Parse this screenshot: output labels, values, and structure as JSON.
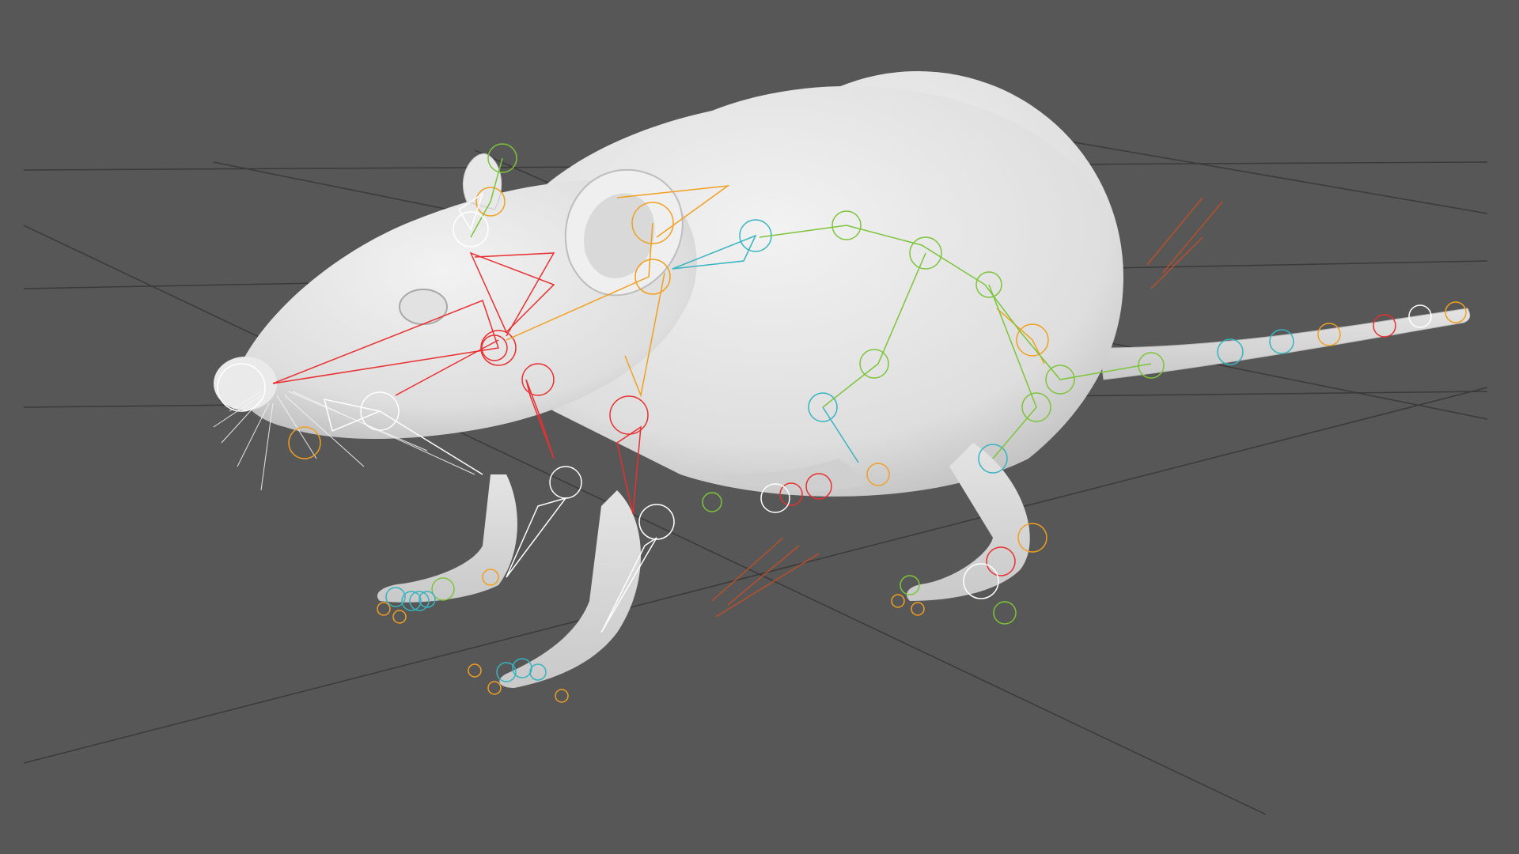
{
  "viewport": {
    "background": "#575757",
    "grid_color": "#3a3a3a",
    "mesh_color": "#e6e6e6"
  },
  "model": {
    "name_icon": "rat-mesh",
    "rig_colors": {
      "head": "#e83030",
      "spine": "#7cc43a",
      "neck": "#36b4c0",
      "shoulder": "#f0a020",
      "limb": "#ffffff",
      "tail": "#36b4c0",
      "ground_marker": "#b8502a"
    }
  }
}
